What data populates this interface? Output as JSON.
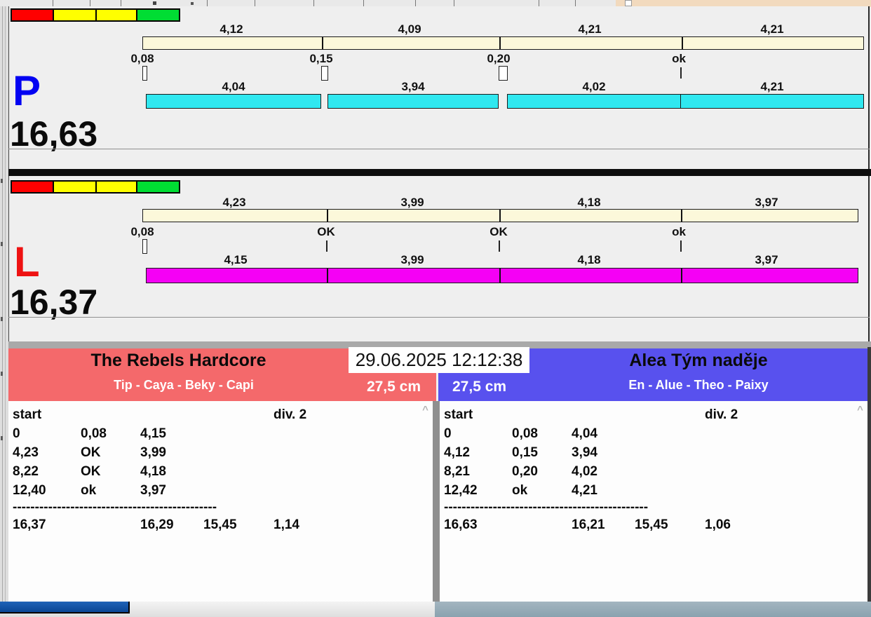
{
  "window": {
    "datetime": "29.06.2025 12:12:38"
  },
  "dashes": "----------------------------------------------",
  "icons": {
    "scroll_up": "^"
  },
  "colors": {
    "lane_p_letter": "#0202f2",
    "lane_l_letter": "#ee1212",
    "split_bar": "#fcf8da",
    "p_dog_bar": "#30e8f0",
    "l_dog_bar": "#f500f5",
    "team_left_bg": "#f4696b",
    "team_right_bg": "#5851ee",
    "traffic_light": [
      "#ff0000",
      "#ffff00",
      "#ffff00",
      "#00dd33"
    ]
  },
  "lanes": [
    {
      "label": "P",
      "total": "16,63",
      "splits": [
        "4,12",
        "4,09",
        "4,21",
        "4,21"
      ],
      "passes": [
        "0,08",
        "0,15",
        "0,20",
        "ok"
      ],
      "dogs": [
        "4,04",
        "3,94",
        "4,02",
        "4,21"
      ]
    },
    {
      "label": "L",
      "total": "16,37",
      "splits": [
        "4,23",
        "3,99",
        "4,18",
        "3,97"
      ],
      "passes": [
        "0,08",
        "OK",
        "OK",
        "ok"
      ],
      "dogs": [
        "4,15",
        "3,99",
        "4,18",
        "3,97"
      ]
    }
  ],
  "panels": [
    {
      "team": "The Rebels Hardcore",
      "dogs": "Tip - Caya - Beky - Capi",
      "height": "27,5 cm",
      "col_start": "start",
      "division": "div.  2",
      "rows": [
        [
          "0",
          "0,08",
          "4,15"
        ],
        [
          "4,23",
          "OK",
          "3,99"
        ],
        [
          "8,22",
          "OK",
          "4,18"
        ],
        [
          "12,40",
          "ok",
          "3,97"
        ]
      ],
      "total": [
        "16,37",
        "16,29",
        "15,45",
        "1,14"
      ]
    },
    {
      "team": "Alea Tým naděje",
      "dogs": "En - Alue - Theo - Paixy",
      "height": "27,5 cm",
      "col_start": "start",
      "division": "div.  2",
      "rows": [
        [
          "0",
          "0,08",
          "4,04"
        ],
        [
          "4,12",
          "0,15",
          "3,94"
        ],
        [
          "8,21",
          "0,20",
          "4,02"
        ],
        [
          "12,42",
          "ok",
          "4,21"
        ]
      ],
      "total": [
        "16,63",
        "16,21",
        "15,45",
        "1,06"
      ]
    }
  ]
}
